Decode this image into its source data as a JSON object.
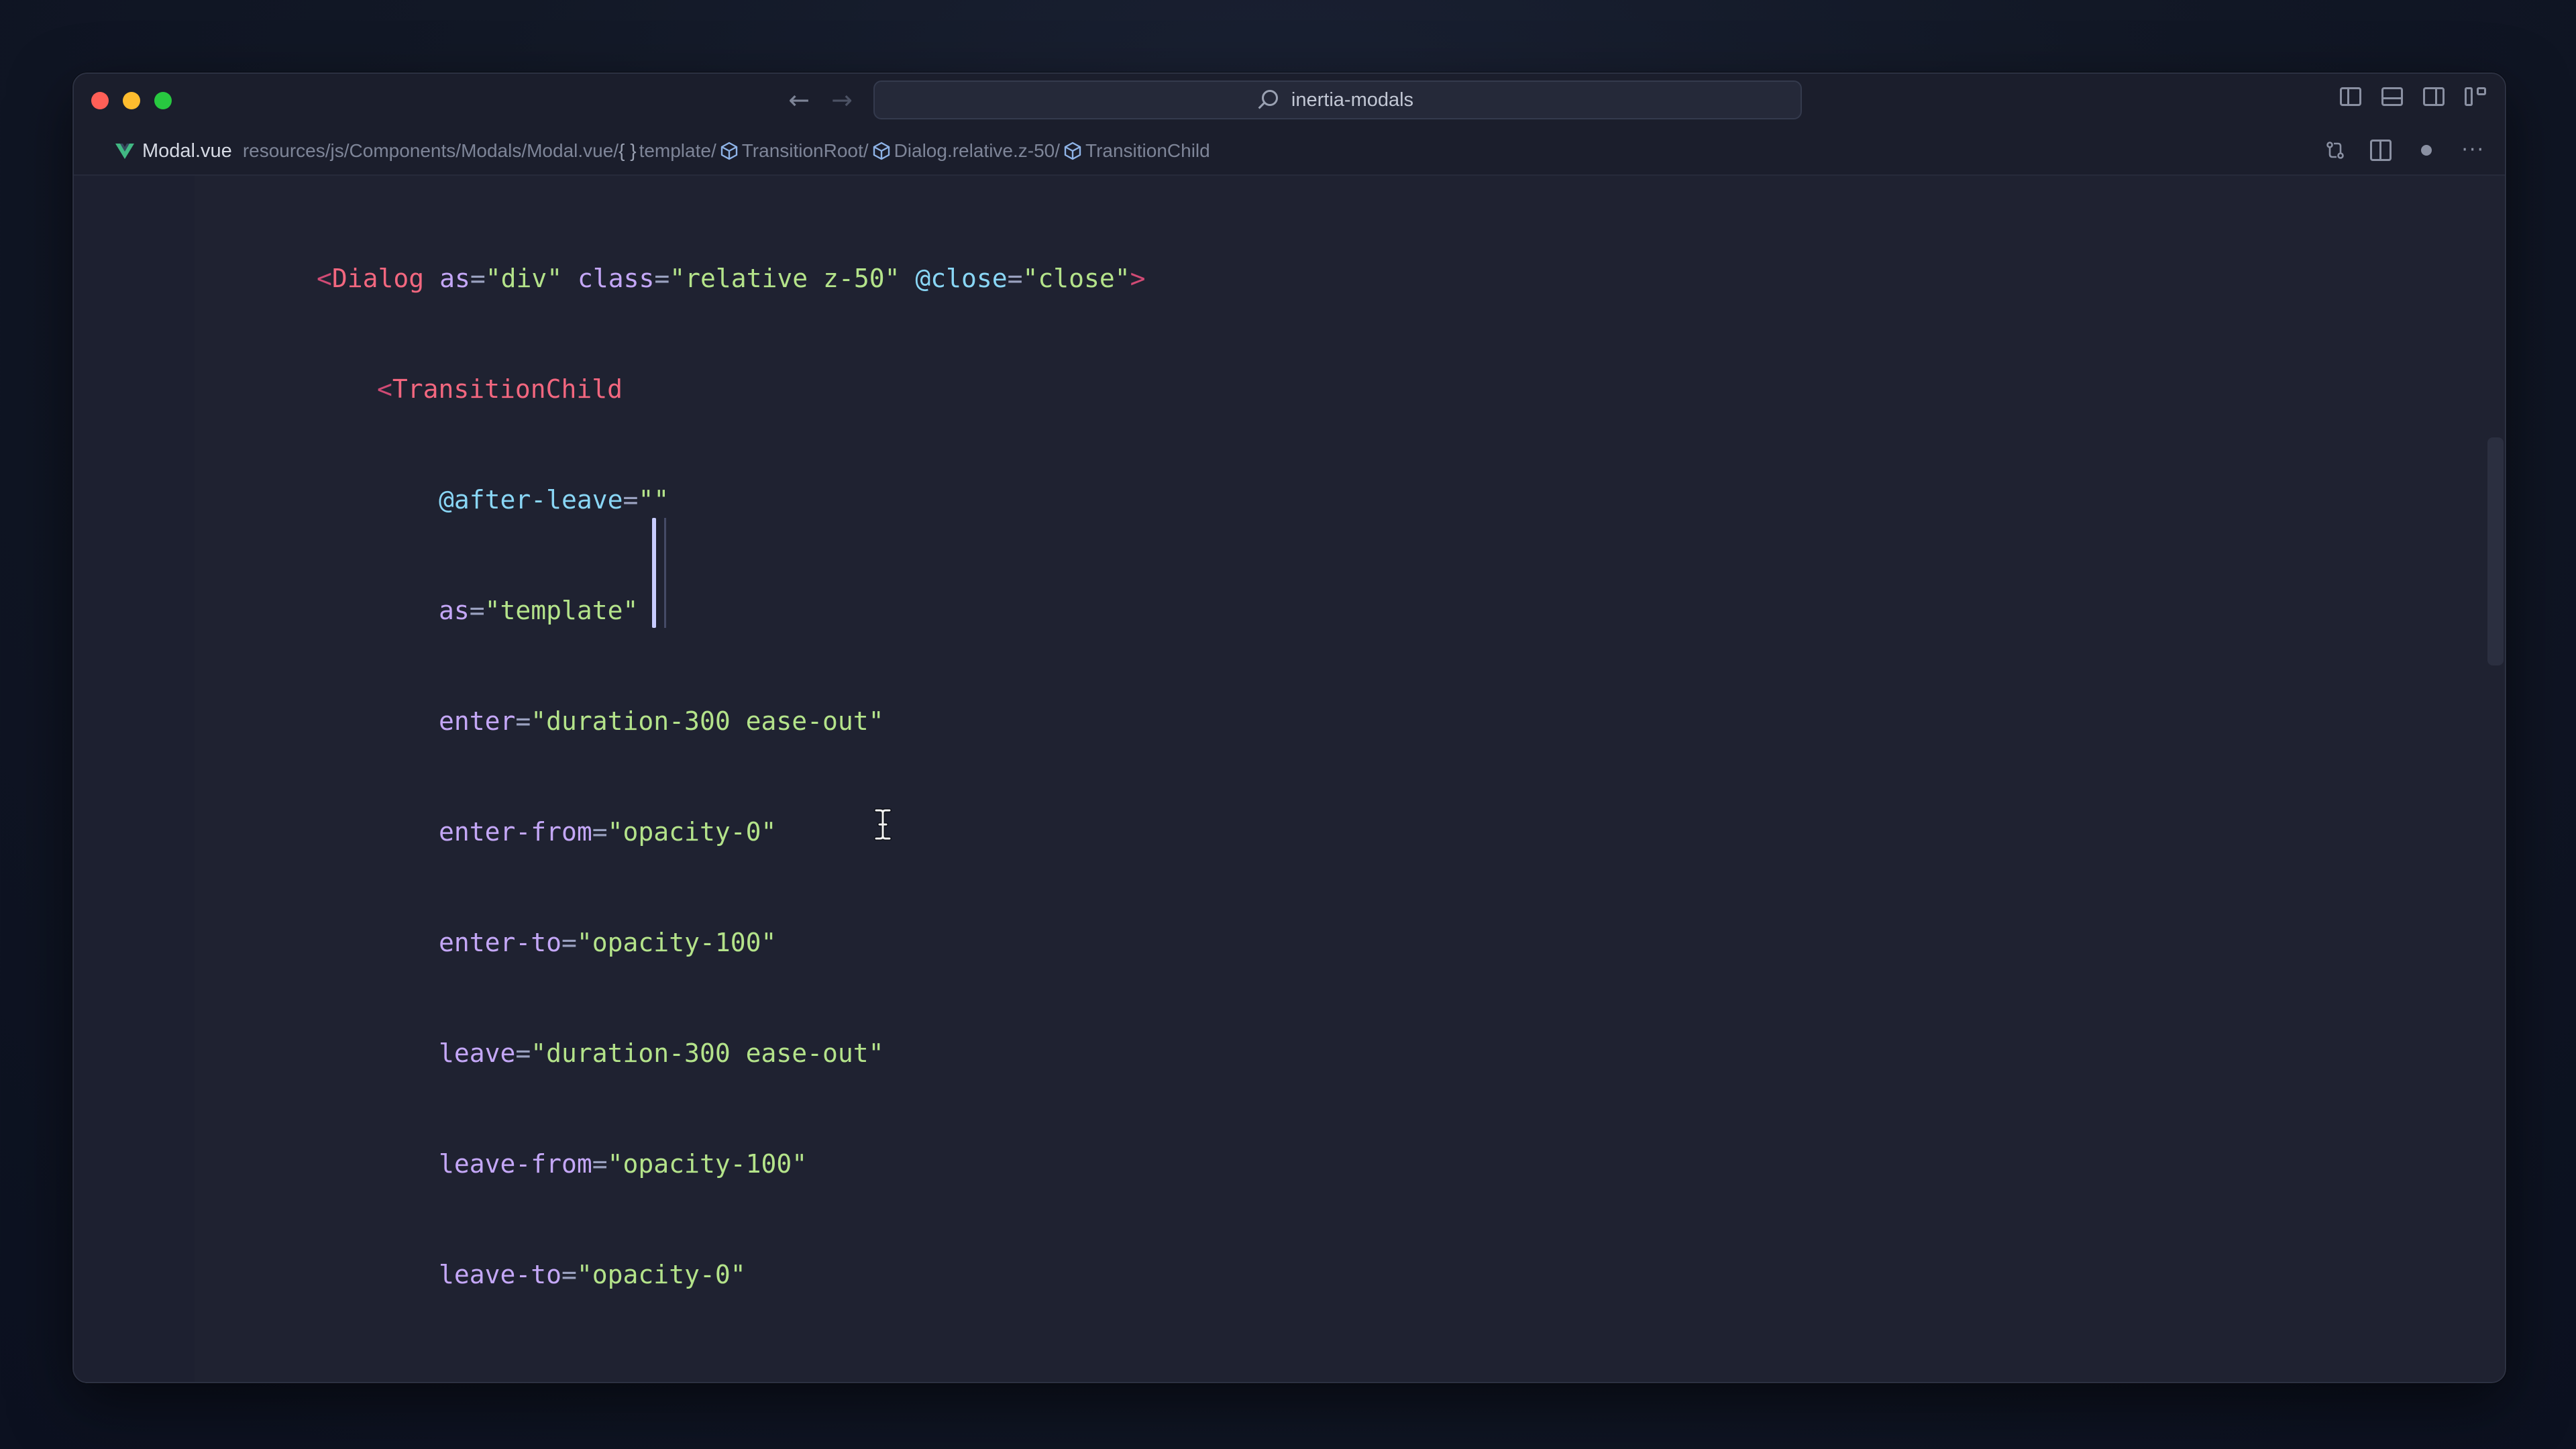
{
  "window": {
    "search_text": "inertia-modals"
  },
  "breadcrumb": {
    "file_name": "Modal.vue",
    "path": "resources/js/Components/Modals/Modal.vue/",
    "braces": "{ }",
    "items": [
      "template/",
      "TransitionRoot/",
      "Dialog.relative.z-50/",
      "TransitionChild"
    ]
  },
  "code": {
    "line1": {
      "open": "<",
      "tag": "Dialog",
      "a1_name": "as",
      "a1_eq": "=",
      "a1_val": "\"div\"",
      "a2_name": "class",
      "a2_eq": "=",
      "a2_val": "\"relative z-50\"",
      "a3_name": "@close",
      "a3_eq": "=",
      "a3_val": "\"close\"",
      "close": ">"
    },
    "line2": {
      "open": "<",
      "tag": "TransitionChild"
    },
    "line3": {
      "name": "@after-leave",
      "eq": "=",
      "val": "\"\""
    },
    "line4": {
      "name": "as",
      "eq": "=",
      "val": "\"template\""
    },
    "line5": {
      "name": "enter",
      "eq": "=",
      "val": "\"duration-300 ease-out\""
    },
    "line6": {
      "name": "enter-from",
      "eq": "=",
      "val": "\"opacity-0\""
    },
    "line7": {
      "name": "enter-to",
      "eq": "=",
      "val": "\"opacity-100\""
    },
    "line8": {
      "name": "leave",
      "eq": "=",
      "val": "\"duration-300 ease-out\""
    },
    "line9": {
      "name": "leave-from",
      "eq": "=",
      "val": "\"opacity-100\""
    },
    "line10": {
      "name": "leave-to",
      "eq": "=",
      "val": "\"opacity-0\""
    }
  },
  "colors": {
    "tag": "#f2677f",
    "attribute": "#c4a7f7",
    "string": "#b4e38a",
    "event": "#89d6f5",
    "editor_bg": "#1f2231"
  },
  "icons": {
    "close": "traffic-light-close",
    "minimize": "traffic-light-minimize",
    "maximize": "traffic-light-maximize",
    "back": "arrow-left-icon",
    "forward": "arrow-right-icon",
    "search": "search-icon",
    "vue": "vue-logo-icon",
    "component": "cube-icon"
  }
}
